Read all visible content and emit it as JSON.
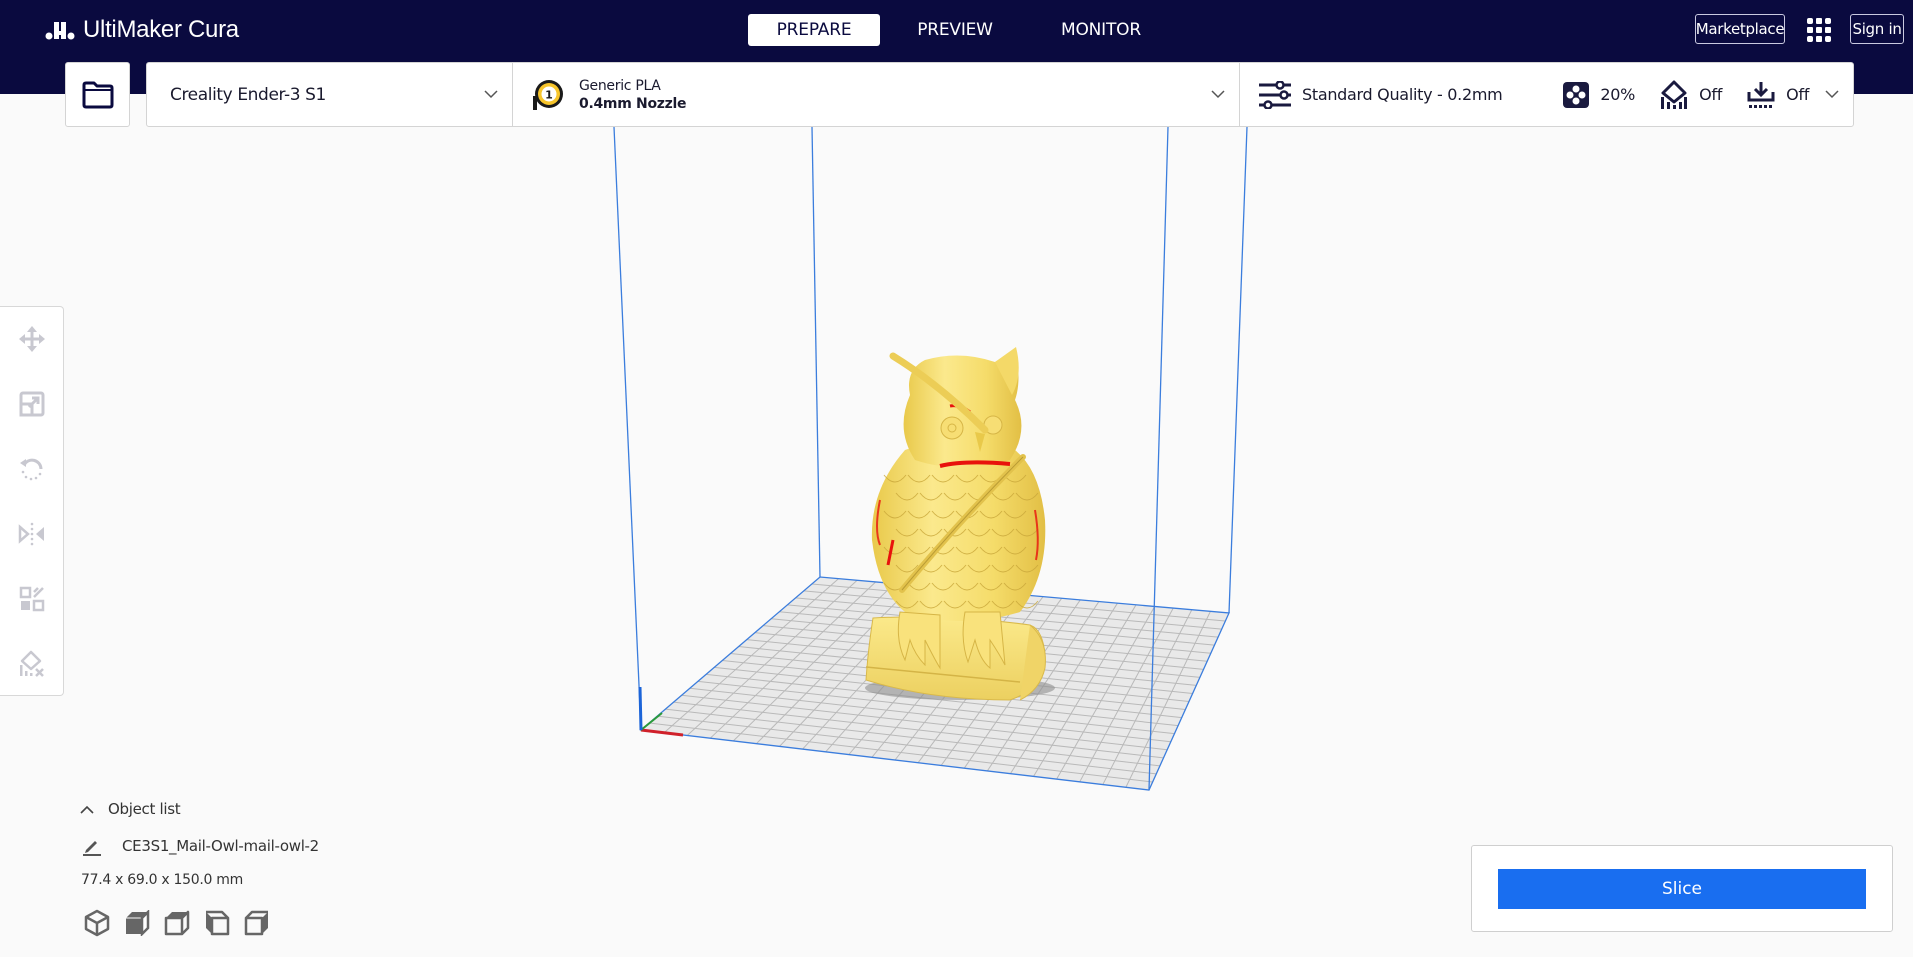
{
  "app": {
    "title": "UltiMaker Cura",
    "logo_icon": "ultimaker-logo-icon"
  },
  "stages": [
    {
      "label": "PREPARE",
      "active": true
    },
    {
      "label": "PREVIEW",
      "active": false
    },
    {
      "label": "MONITOR",
      "active": false
    }
  ],
  "header_buttons": {
    "marketplace": "Marketplace",
    "apps_icon": "apps-grid-icon",
    "sign_in": "Sign in"
  },
  "toolbar": {
    "open_file_icon": "folder-icon",
    "printer": {
      "name": "Creality Ender-3 S1"
    },
    "extruder": {
      "number": "1",
      "material": "Generic PLA",
      "nozzle": "0.4mm Nozzle",
      "material_color": "#f7c52b"
    },
    "print_settings": {
      "profile": "Standard Quality - 0.2mm",
      "infill": "20%",
      "support": "Off",
      "adhesion": "Off"
    }
  },
  "tools": [
    {
      "name": "move",
      "icon": "move-icon"
    },
    {
      "name": "scale",
      "icon": "scale-icon"
    },
    {
      "name": "rotate",
      "icon": "rotate-icon"
    },
    {
      "name": "mirror",
      "icon": "mirror-icon"
    },
    {
      "name": "per-model-settings",
      "icon": "per-model-settings-icon"
    },
    {
      "name": "support-blocker",
      "icon": "support-blocker-icon"
    }
  ],
  "object_list": {
    "header": "Object list",
    "object_name": "CE3S1_Mail-Owl-mail-owl-2",
    "dimensions": "77.4 x 69.0 x 150.0 mm",
    "view_buttons": [
      "3d-view",
      "front-view",
      "top-view",
      "left-view",
      "right-view"
    ]
  },
  "slice": {
    "label": "Slice",
    "color": "#196ef0"
  },
  "scene": {
    "model_color": "#f8e27a",
    "overhang_color": "#e8120c",
    "volume_line_color": "#3b7ddd",
    "plate_color": "#e9e9e9",
    "grid_color": "#b9b9b9",
    "axis_colors": {
      "x": "#d0202a",
      "y": "#2a9a3a",
      "z": "#1c64d8"
    }
  }
}
